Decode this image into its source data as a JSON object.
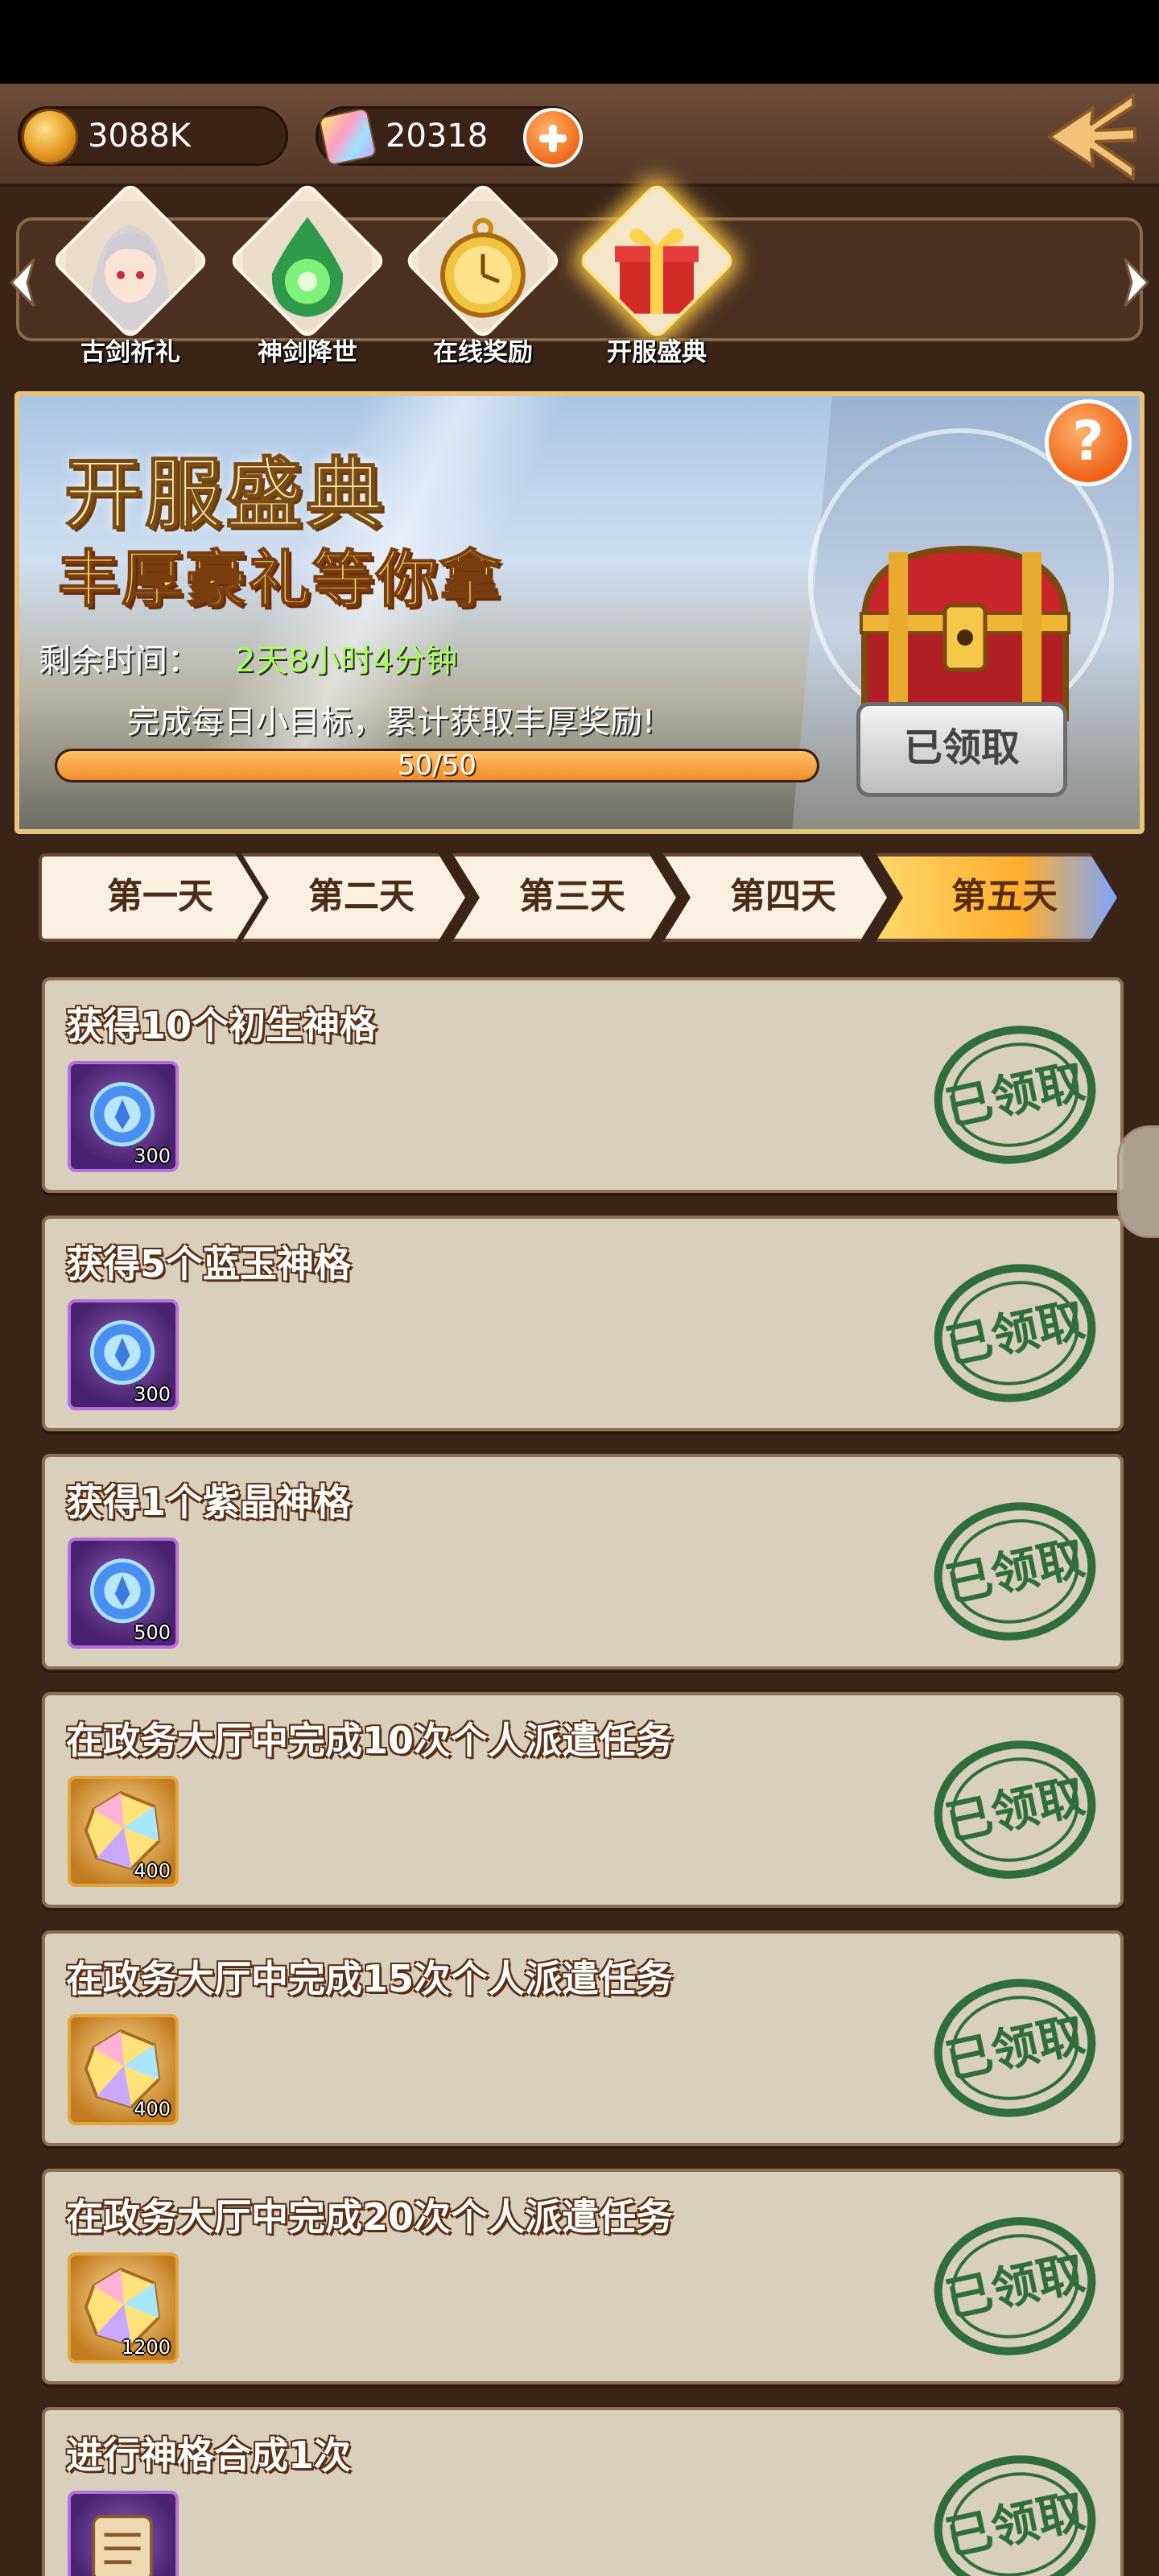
{
  "resources": {
    "gold": {
      "icon": "gold-coin-icon",
      "value": "3088K"
    },
    "gem": {
      "icon": "gem-icon",
      "value": "20318"
    }
  },
  "nav": {
    "items": [
      {
        "label": "古剑祈礼"
      },
      {
        "label": "神剑降世"
      },
      {
        "label": "在线奖励"
      },
      {
        "label": "开服盛典"
      }
    ],
    "selected": "开服盛典"
  },
  "banner": {
    "title": "开服盛典",
    "subtitle": "丰厚豪礼等你拿",
    "time_label": "剩余时间：",
    "time_value": "2天8小时4分钟",
    "description": "完成每日小目标，累计获取丰厚奖励!",
    "progress": {
      "current": 50,
      "total": 50,
      "text": "50/50"
    },
    "help": "?",
    "chest_button": "已领取"
  },
  "tabs": [
    {
      "label": "第一天"
    },
    {
      "label": "第二天"
    },
    {
      "label": "第三天"
    },
    {
      "label": "第四天"
    },
    {
      "label": "第五天"
    }
  ],
  "active_tab": "第五天",
  "tasks": [
    {
      "title": "获得10个初生神格",
      "reward_icon": "divinity-orb-icon",
      "qty": "300",
      "stamp": "已领取"
    },
    {
      "title": "获得5个蓝玉神格",
      "reward_icon": "divinity-orb-icon",
      "qty": "300",
      "stamp": "已领取"
    },
    {
      "title": "获得1个紫晶神格",
      "reward_icon": "divinity-orb-icon",
      "qty": "500",
      "stamp": "已领取"
    },
    {
      "title": "在政务大厅中完成10次个人派遣任务",
      "reward_icon": "gem-icon",
      "qty": "400",
      "stamp": "已领取"
    },
    {
      "title": "在政务大厅中完成15次个人派遣任务",
      "reward_icon": "gem-icon",
      "qty": "400",
      "stamp": "已领取"
    },
    {
      "title": "在政务大厅中完成20次个人派遣任务",
      "reward_icon": "gem-icon",
      "qty": "1200",
      "stamp": "已领取"
    },
    {
      "title": "进行神格合成1次",
      "reward_icon": "scroll-icon",
      "qty": "",
      "stamp": "已领取"
    }
  ],
  "colors": {
    "accent": "#f07a2a",
    "panel": "#d8cfbd",
    "stamp": "#2f6e3a",
    "frame": "#3a2418"
  }
}
